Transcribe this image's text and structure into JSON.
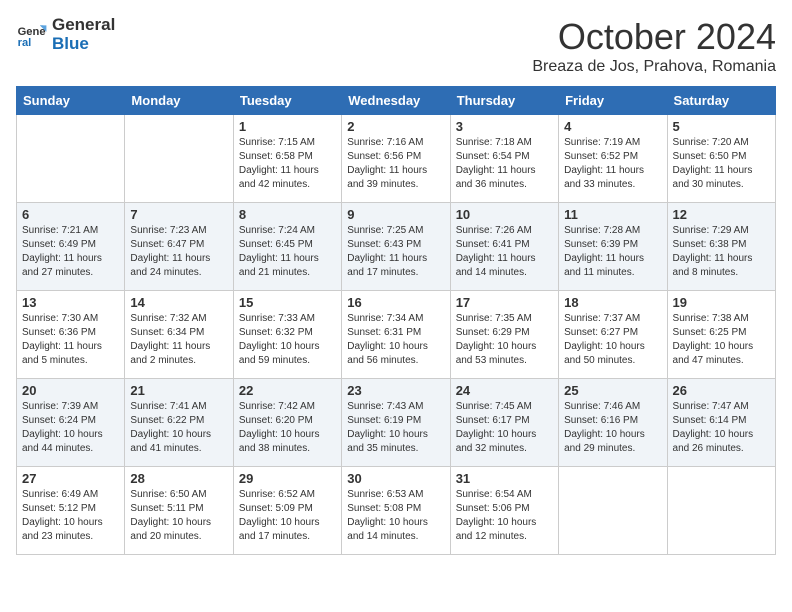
{
  "header": {
    "logo_line1": "General",
    "logo_line2": "Blue",
    "month": "October 2024",
    "location": "Breaza de Jos, Prahova, Romania"
  },
  "days_of_week": [
    "Sunday",
    "Monday",
    "Tuesday",
    "Wednesday",
    "Thursday",
    "Friday",
    "Saturday"
  ],
  "weeks": [
    [
      {
        "day": "",
        "info": ""
      },
      {
        "day": "",
        "info": ""
      },
      {
        "day": "1",
        "info": "Sunrise: 7:15 AM\nSunset: 6:58 PM\nDaylight: 11 hours and 42 minutes."
      },
      {
        "day": "2",
        "info": "Sunrise: 7:16 AM\nSunset: 6:56 PM\nDaylight: 11 hours and 39 minutes."
      },
      {
        "day": "3",
        "info": "Sunrise: 7:18 AM\nSunset: 6:54 PM\nDaylight: 11 hours and 36 minutes."
      },
      {
        "day": "4",
        "info": "Sunrise: 7:19 AM\nSunset: 6:52 PM\nDaylight: 11 hours and 33 minutes."
      },
      {
        "day": "5",
        "info": "Sunrise: 7:20 AM\nSunset: 6:50 PM\nDaylight: 11 hours and 30 minutes."
      }
    ],
    [
      {
        "day": "6",
        "info": "Sunrise: 7:21 AM\nSunset: 6:49 PM\nDaylight: 11 hours and 27 minutes."
      },
      {
        "day": "7",
        "info": "Sunrise: 7:23 AM\nSunset: 6:47 PM\nDaylight: 11 hours and 24 minutes."
      },
      {
        "day": "8",
        "info": "Sunrise: 7:24 AM\nSunset: 6:45 PM\nDaylight: 11 hours and 21 minutes."
      },
      {
        "day": "9",
        "info": "Sunrise: 7:25 AM\nSunset: 6:43 PM\nDaylight: 11 hours and 17 minutes."
      },
      {
        "day": "10",
        "info": "Sunrise: 7:26 AM\nSunset: 6:41 PM\nDaylight: 11 hours and 14 minutes."
      },
      {
        "day": "11",
        "info": "Sunrise: 7:28 AM\nSunset: 6:39 PM\nDaylight: 11 hours and 11 minutes."
      },
      {
        "day": "12",
        "info": "Sunrise: 7:29 AM\nSunset: 6:38 PM\nDaylight: 11 hours and 8 minutes."
      }
    ],
    [
      {
        "day": "13",
        "info": "Sunrise: 7:30 AM\nSunset: 6:36 PM\nDaylight: 11 hours and 5 minutes."
      },
      {
        "day": "14",
        "info": "Sunrise: 7:32 AM\nSunset: 6:34 PM\nDaylight: 11 hours and 2 minutes."
      },
      {
        "day": "15",
        "info": "Sunrise: 7:33 AM\nSunset: 6:32 PM\nDaylight: 10 hours and 59 minutes."
      },
      {
        "day": "16",
        "info": "Sunrise: 7:34 AM\nSunset: 6:31 PM\nDaylight: 10 hours and 56 minutes."
      },
      {
        "day": "17",
        "info": "Sunrise: 7:35 AM\nSunset: 6:29 PM\nDaylight: 10 hours and 53 minutes."
      },
      {
        "day": "18",
        "info": "Sunrise: 7:37 AM\nSunset: 6:27 PM\nDaylight: 10 hours and 50 minutes."
      },
      {
        "day": "19",
        "info": "Sunrise: 7:38 AM\nSunset: 6:25 PM\nDaylight: 10 hours and 47 minutes."
      }
    ],
    [
      {
        "day": "20",
        "info": "Sunrise: 7:39 AM\nSunset: 6:24 PM\nDaylight: 10 hours and 44 minutes."
      },
      {
        "day": "21",
        "info": "Sunrise: 7:41 AM\nSunset: 6:22 PM\nDaylight: 10 hours and 41 minutes."
      },
      {
        "day": "22",
        "info": "Sunrise: 7:42 AM\nSunset: 6:20 PM\nDaylight: 10 hours and 38 minutes."
      },
      {
        "day": "23",
        "info": "Sunrise: 7:43 AM\nSunset: 6:19 PM\nDaylight: 10 hours and 35 minutes."
      },
      {
        "day": "24",
        "info": "Sunrise: 7:45 AM\nSunset: 6:17 PM\nDaylight: 10 hours and 32 minutes."
      },
      {
        "day": "25",
        "info": "Sunrise: 7:46 AM\nSunset: 6:16 PM\nDaylight: 10 hours and 29 minutes."
      },
      {
        "day": "26",
        "info": "Sunrise: 7:47 AM\nSunset: 6:14 PM\nDaylight: 10 hours and 26 minutes."
      }
    ],
    [
      {
        "day": "27",
        "info": "Sunrise: 6:49 AM\nSunset: 5:12 PM\nDaylight: 10 hours and 23 minutes."
      },
      {
        "day": "28",
        "info": "Sunrise: 6:50 AM\nSunset: 5:11 PM\nDaylight: 10 hours and 20 minutes."
      },
      {
        "day": "29",
        "info": "Sunrise: 6:52 AM\nSunset: 5:09 PM\nDaylight: 10 hours and 17 minutes."
      },
      {
        "day": "30",
        "info": "Sunrise: 6:53 AM\nSunset: 5:08 PM\nDaylight: 10 hours and 14 minutes."
      },
      {
        "day": "31",
        "info": "Sunrise: 6:54 AM\nSunset: 5:06 PM\nDaylight: 10 hours and 12 minutes."
      },
      {
        "day": "",
        "info": ""
      },
      {
        "day": "",
        "info": ""
      }
    ]
  ]
}
